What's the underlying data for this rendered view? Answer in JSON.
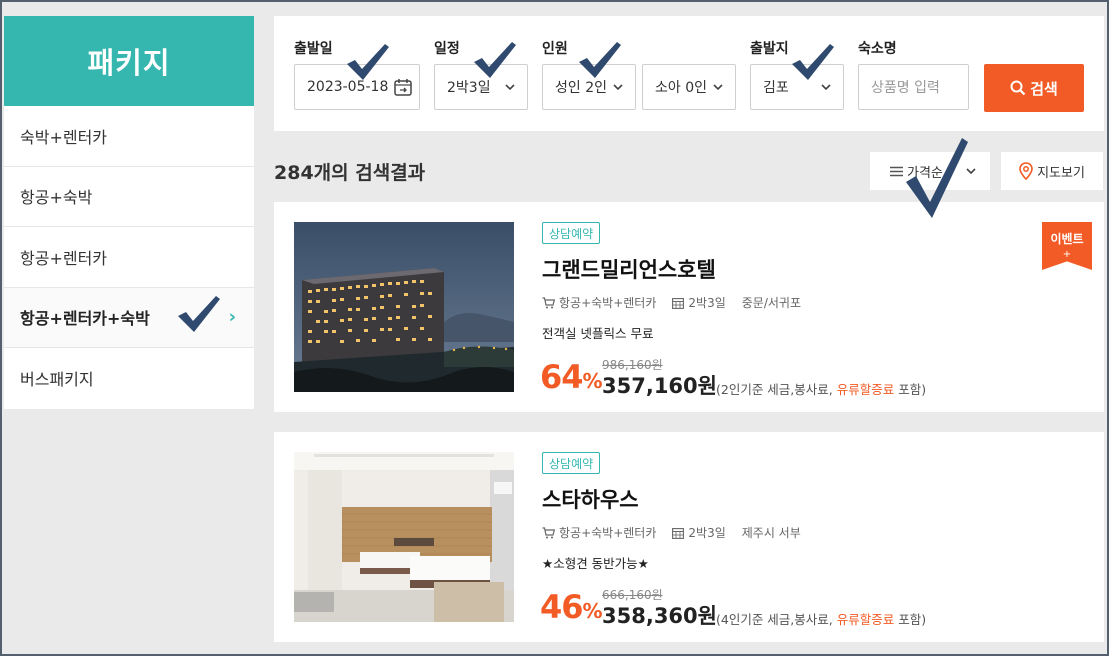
{
  "sidebar": {
    "title": "패키지",
    "items": [
      {
        "label": "숙박+렌터카"
      },
      {
        "label": "항공+숙박"
      },
      {
        "label": "항공+렌터카"
      },
      {
        "label": "항공+렌터카+숙박",
        "active": true
      },
      {
        "label": "버스패키지"
      }
    ]
  },
  "search": {
    "departure_date": {
      "label": "출발일",
      "value": "2023-05-18"
    },
    "schedule": {
      "label": "일정",
      "value": "2박3일"
    },
    "people": {
      "label": "인원",
      "adult_value": "성인 2인",
      "child_value": "소아 0인"
    },
    "origin": {
      "label": "출발지",
      "value": "김포"
    },
    "hotel_name": {
      "label": "숙소명",
      "placeholder": "상품명 입력"
    },
    "search_button": "검색"
  },
  "results": {
    "count_text": "284개의 검색결과",
    "sort_label": "가격순",
    "map_label": "지도보기"
  },
  "cards": [
    {
      "badge": "상담예약",
      "name": "그랜드밀리언스호텔",
      "type": "항공+숙박+렌터카",
      "duration": "2박3일",
      "area": "중문/서귀포",
      "desc": "전객실 넷플릭스 무료",
      "discount": "64",
      "pct": "%",
      "orig_price": "986,160원",
      "price": "357,160원",
      "note_pre": "(2인기준 세금,봉사료, ",
      "note_hl": "유류할증료",
      "note_post": " 포함)",
      "event": "이벤트",
      "event_plus": "+"
    },
    {
      "badge": "상담예약",
      "name": "스타하우스",
      "type": "항공+숙박+렌터카",
      "duration": "2박3일",
      "area": "제주시 서부",
      "desc": "★소형견 동반가능★",
      "discount": "46",
      "pct": "%",
      "orig_price": "666,160원",
      "price": "358,360원",
      "note_pre": "(4인기준 세금,봉사료, ",
      "note_hl": "유류할증료",
      "note_post": " 포함)"
    }
  ],
  "colors": {
    "accent": "#35b7b0",
    "orange": "#f25b25",
    "check": "#2f4a6e"
  }
}
